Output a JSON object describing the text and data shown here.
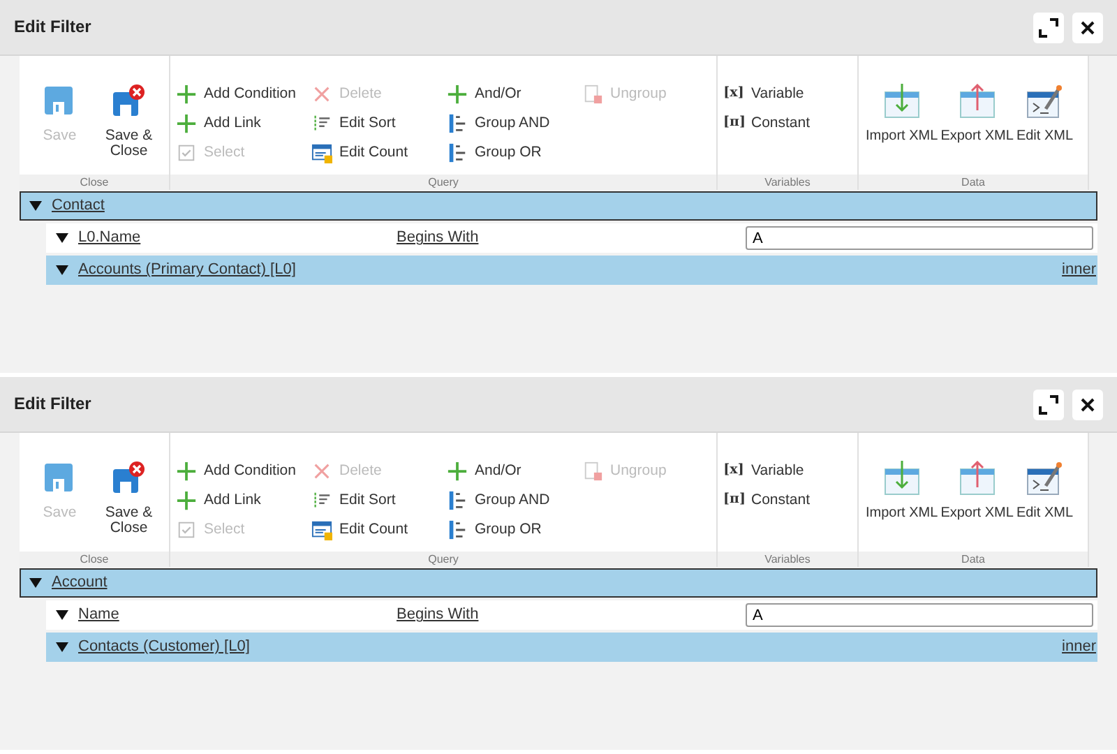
{
  "panels": [
    {
      "title": "Edit Filter",
      "ribbon": [
        {
          "label": "Close",
          "items": [
            {
              "label": "Save",
              "kind": "large",
              "disabled": true
            },
            {
              "label": "Save & Close",
              "kind": "large",
              "disabled": false
            }
          ]
        },
        {
          "label": "Query",
          "items": [
            {
              "label": "Add Condition",
              "kind": "small",
              "disabled": false
            },
            {
              "label": "Add Link",
              "kind": "small",
              "disabled": false
            },
            {
              "label": "Select",
              "kind": "small",
              "disabled": true
            },
            {
              "label": "Delete",
              "kind": "small",
              "disabled": true
            },
            {
              "label": "Edit Sort",
              "kind": "small",
              "disabled": false
            },
            {
              "label": "Edit Count",
              "kind": "small",
              "disabled": false
            },
            {
              "label": "And/Or",
              "kind": "small",
              "disabled": false
            },
            {
              "label": "Group AND",
              "kind": "small",
              "disabled": false
            },
            {
              "label": "Group OR",
              "kind": "small",
              "disabled": false
            },
            {
              "label": "Ungroup",
              "kind": "small",
              "disabled": true
            }
          ]
        },
        {
          "label": "Variables",
          "items": [
            {
              "label": "Variable",
              "kind": "small",
              "glyph": "[x]",
              "disabled": false
            },
            {
              "label": "Constant",
              "kind": "small",
              "glyph": "[π]",
              "disabled": false
            }
          ]
        },
        {
          "label": "Data",
          "items": [
            {
              "label": "Import XML",
              "kind": "large",
              "disabled": false
            },
            {
              "label": "Export XML",
              "kind": "large",
              "disabled": false
            },
            {
              "label": "Edit XML",
              "kind": "large",
              "disabled": false
            }
          ]
        }
      ],
      "tree": {
        "kind": "entity",
        "label": "Contact",
        "expanded": true,
        "selected": true,
        "children": [
          {
            "kind": "condition",
            "field": "L0.Name",
            "operator": "Begins With",
            "value": "A",
            "expanded": true,
            "selected": false
          },
          {
            "kind": "link",
            "label": "Accounts (Primary Contact) [L0]",
            "join": "inner",
            "expanded": true,
            "selected": false
          }
        ]
      }
    },
    {
      "title": "Edit Filter",
      "ribbon": [
        {
          "label": "Close",
          "items": [
            {
              "label": "Save",
              "kind": "large",
              "disabled": true
            },
            {
              "label": "Save & Close",
              "kind": "large",
              "disabled": false
            }
          ]
        },
        {
          "label": "Query",
          "items": [
            {
              "label": "Add Condition",
              "kind": "small",
              "disabled": false
            },
            {
              "label": "Add Link",
              "kind": "small",
              "disabled": false
            },
            {
              "label": "Select",
              "kind": "small",
              "disabled": true
            },
            {
              "label": "Delete",
              "kind": "small",
              "disabled": true
            },
            {
              "label": "Edit Sort",
              "kind": "small",
              "disabled": false
            },
            {
              "label": "Edit Count",
              "kind": "small",
              "disabled": false
            },
            {
              "label": "And/Or",
              "kind": "small",
              "disabled": false
            },
            {
              "label": "Group AND",
              "kind": "small",
              "disabled": false
            },
            {
              "label": "Group OR",
              "kind": "small",
              "disabled": false
            },
            {
              "label": "Ungroup",
              "kind": "small",
              "disabled": true
            }
          ]
        },
        {
          "label": "Variables",
          "items": [
            {
              "label": "Variable",
              "kind": "small",
              "glyph": "[x]",
              "disabled": false
            },
            {
              "label": "Constant",
              "kind": "small",
              "glyph": "[π]",
              "disabled": false
            }
          ]
        },
        {
          "label": "Data",
          "items": [
            {
              "label": "Import XML",
              "kind": "large",
              "disabled": false
            },
            {
              "label": "Export XML",
              "kind": "large",
              "disabled": false
            },
            {
              "label": "Edit XML",
              "kind": "large",
              "disabled": false
            }
          ]
        }
      ],
      "tree": {
        "kind": "entity",
        "label": "Account",
        "expanded": true,
        "selected": true,
        "children": [
          {
            "kind": "condition",
            "field": "Name",
            "operator": "Begins With",
            "value": "A",
            "expanded": true,
            "selected": false
          },
          {
            "kind": "link",
            "label": "Contacts (Customer) [L0]",
            "join": "inner",
            "expanded": true,
            "selected": false
          }
        ]
      }
    }
  ]
}
